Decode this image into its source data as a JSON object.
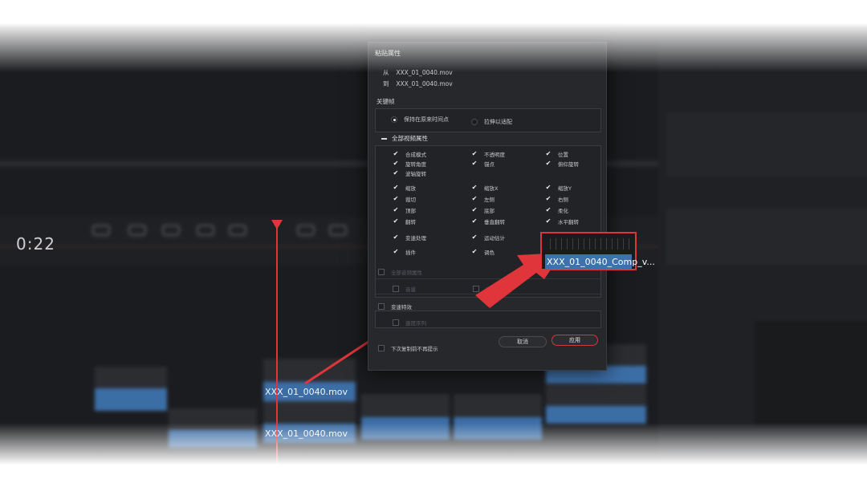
{
  "dialog": {
    "title": "粘贴属性",
    "from_key": "从",
    "from_value": "XXX_01_0040.mov",
    "to_key": "到",
    "to_value": "XXX_01_0040.mov",
    "keyframes_label": "关键帧",
    "keyframe_options": [
      {
        "label": "保持在原来时间点",
        "selected": true
      },
      {
        "label": "拉伸以适配",
        "selected": false
      }
    ],
    "video_section_label": "全部视频属性",
    "video_group1": [
      [
        "合成模式",
        "不透明度",
        "位置"
      ],
      [
        "旋转角度",
        "锚点",
        "俯仰旋转"
      ],
      [
        "波轴旋转",
        "",
        ""
      ]
    ],
    "video_group2": [
      [
        "缩放",
        "缩放X",
        "缩放Y"
      ],
      [
        "裁切",
        "左侧",
        "右侧"
      ],
      [
        "顶部",
        "底部",
        "柔化"
      ],
      [
        "翻转",
        "垂直翻转",
        "水平翻转"
      ]
    ],
    "video_group3": [
      [
        "变速处理",
        "运动估计"
      ],
      [
        "插件",
        "调色"
      ]
    ],
    "audio_section_label": "全部音频属性",
    "audio_items": [
      "音量",
      "声像"
    ],
    "speed_section_label": "变速特效",
    "speed_item": "速度序列",
    "dont_show_label": "下次复制前不再提示",
    "cancel_label": "取消",
    "apply_label": "应用"
  },
  "timeline": {
    "timecode": "0:22",
    "clip_label_1": "XXX_01_0040.mov",
    "clip_label_2": "XXX_01_0040.mov"
  },
  "callout": {
    "clip_label": "XXX_01_0040_Comp_v..."
  },
  "colors": {
    "highlight_red": "#e0353a",
    "clip_blue": "#3e72ab",
    "dialog_bg": "#27282c"
  }
}
